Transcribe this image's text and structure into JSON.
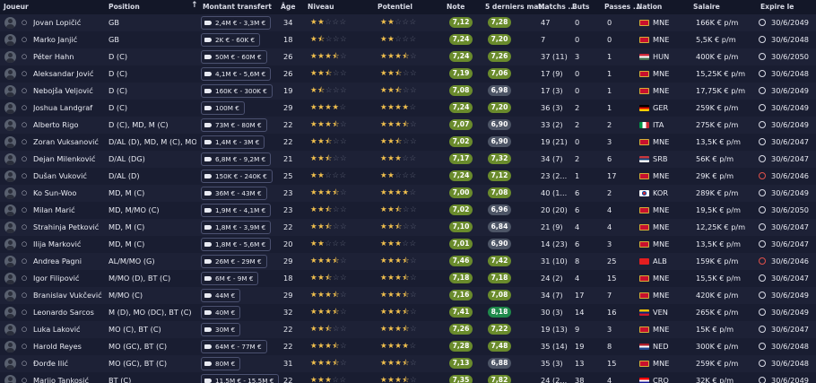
{
  "headers": {
    "player": "Joueur",
    "position": "Position",
    "transfer": "Montant transfert",
    "age": "Âge",
    "level": "Niveau",
    "potential": "Potentiel",
    "rating": "Note",
    "last5": "5 derniers mat...",
    "matches": "Matchs ...",
    "goals": "Buts",
    "assists": "Passes ...",
    "nation": "Nation",
    "salary": "Salaire",
    "expires": "Expire le",
    "sort_arrow": "↑"
  },
  "colors": {
    "background": "#161a2c",
    "note_green": "#6a8b2c",
    "star": "#f2c14e",
    "green_dark": "#1f8a4b",
    "grey_badge": "#4d5566",
    "expired_red": "#e0504a"
  },
  "players": [
    {
      "name": "Jovan Lopičić",
      "position": "GB",
      "transfer": "2,4M € - 3,3M €",
      "age": "34",
      "level": 2,
      "potential": 2,
      "note": "7,12",
      "last5": "7,28",
      "last5_style": "g1",
      "matches": "47",
      "goals": "0",
      "assists": "0",
      "flag": "mne",
      "nation": "MNE",
      "salary": "166K € p/m",
      "clock": "normal",
      "expires": "30/6/2049"
    },
    {
      "name": "Marko Janjić",
      "position": "GB",
      "transfer": "2K € - 60K €",
      "age": "18",
      "level": 1.5,
      "potential": 2,
      "note": "7,24",
      "last5": "7,20",
      "last5_style": "g1",
      "matches": "7",
      "goals": "0",
      "assists": "0",
      "flag": "mne",
      "nation": "MNE",
      "salary": "5,5K € p/m",
      "clock": "normal",
      "expires": "30/6/2048"
    },
    {
      "name": "Péter Hahn",
      "position": "D (C)",
      "transfer": "50M € - 60M €",
      "age": "26",
      "level": 3.5,
      "potential": 3.5,
      "note": "7,24",
      "last5": "7,26",
      "last5_style": "g1",
      "matches": "37 (11)",
      "goals": "3",
      "assists": "1",
      "flag": "hun",
      "nation": "HUN",
      "salary": "400K € p/m",
      "clock": "normal",
      "expires": "30/6/2050"
    },
    {
      "name": "Aleksandar Jović",
      "position": "D (C)",
      "transfer": "4,1M € - 5,6M €",
      "age": "26",
      "level": 2.5,
      "potential": 2.5,
      "note": "7,19",
      "last5": "7,06",
      "last5_style": "g1",
      "matches": "17 (9)",
      "goals": "0",
      "assists": "1",
      "flag": "mne",
      "nation": "MNE",
      "salary": "15,25K € p/m",
      "clock": "normal",
      "expires": "30/6/2048"
    },
    {
      "name": "Nebojša Veljović",
      "position": "D (C)",
      "transfer": "160K € - 300K €",
      "age": "19",
      "level": 1.5,
      "potential": 2.5,
      "note": "7,08",
      "last5": "6,98",
      "last5_style": "g2",
      "matches": "17 (3)",
      "goals": "0",
      "assists": "1",
      "flag": "mne",
      "nation": "MNE",
      "salary": "17,75K € p/m",
      "clock": "normal",
      "expires": "30/6/2049"
    },
    {
      "name": "Joshua Landgraf",
      "position": "D (C)",
      "transfer": "100M €",
      "age": "29",
      "level": 4,
      "potential": 4,
      "note": "7,24",
      "last5": "7,20",
      "last5_style": "g1",
      "matches": "36 (3)",
      "goals": "2",
      "assists": "1",
      "flag": "ger",
      "nation": "GER",
      "salary": "259K € p/m",
      "clock": "normal",
      "expires": "30/6/2049"
    },
    {
      "name": "Alberto Rigo",
      "position": "D (C), MD, M (C)",
      "transfer": "73M € - 80M €",
      "age": "22",
      "level": 3.5,
      "potential": 3.5,
      "note": "7,07",
      "last5": "6,90",
      "last5_style": "g2",
      "matches": "33 (2)",
      "goals": "2",
      "assists": "2",
      "flag": "ita",
      "nation": "ITA",
      "salary": "275K € p/m",
      "clock": "normal",
      "expires": "30/6/2049"
    },
    {
      "name": "Zoran Vuksanović",
      "position": "D/AL (D), MD, M (C), MO...",
      "transfer": "1,4M € - 3M €",
      "age": "22",
      "level": 2.5,
      "potential": 2.5,
      "note": "7,02",
      "last5": "6,90",
      "last5_style": "g2",
      "matches": "19 (21)",
      "goals": "0",
      "assists": "3",
      "flag": "mne",
      "nation": "MNE",
      "salary": "13,5K € p/m",
      "clock": "normal",
      "expires": "30/6/2047"
    },
    {
      "name": "Dejan Milenković",
      "position": "D/AL (DG)",
      "transfer": "6,8M € - 9,2M €",
      "age": "21",
      "level": 2.5,
      "potential": 3,
      "note": "7,17",
      "last5": "7,32",
      "last5_style": "g1",
      "matches": "34 (7)",
      "goals": "2",
      "assists": "6",
      "flag": "srb",
      "nation": "SRB",
      "salary": "56K € p/m",
      "clock": "normal",
      "expires": "30/6/2047"
    },
    {
      "name": "Dušan Vuković",
      "position": "D/AL (D)",
      "transfer": "150K € - 240K €",
      "age": "25",
      "level": 2,
      "potential": 2,
      "note": "7,24",
      "last5": "7,12",
      "last5_style": "g1",
      "matches": "23 (2...",
      "goals": "1",
      "assists": "17",
      "flag": "mne",
      "nation": "MNE",
      "salary": "29K € p/m",
      "clock": "red",
      "expires": "30/6/2046"
    },
    {
      "name": "Ko Sun-Woo",
      "position": "MD, M (C)",
      "transfer": "36M € - 43M €",
      "age": "23",
      "level": 3.5,
      "potential": 4,
      "note": "7,00",
      "last5": "7,08",
      "last5_style": "g1",
      "matches": "40 (1...",
      "goals": "6",
      "assists": "2",
      "flag": "kor",
      "nation": "KOR",
      "salary": "289K € p/m",
      "clock": "normal",
      "expires": "30/6/2049"
    },
    {
      "name": "Milan Marić",
      "position": "MD, M/MO (C)",
      "transfer": "1,9M € - 4,1M €",
      "age": "23",
      "level": 2.5,
      "potential": 2.5,
      "note": "7,02",
      "last5": "6,96",
      "last5_style": "g2",
      "matches": "20 (20)",
      "goals": "6",
      "assists": "4",
      "flag": "mne",
      "nation": "MNE",
      "salary": "19,5K € p/m",
      "clock": "normal",
      "expires": "30/6/2050"
    },
    {
      "name": "Strahinja Petković",
      "position": "MD, M (C)",
      "transfer": "1,8M € - 3,9M €",
      "age": "22",
      "level": 2.5,
      "potential": 2.5,
      "note": "7,10",
      "last5": "6,84",
      "last5_style": "g2",
      "matches": "21 (9)",
      "goals": "4",
      "assists": "4",
      "flag": "mne",
      "nation": "MNE",
      "salary": "12,25K € p/m",
      "clock": "normal",
      "expires": "30/6/2047"
    },
    {
      "name": "Ilija Marković",
      "position": "MD, M (C)",
      "transfer": "1,8M € - 5,6M €",
      "age": "20",
      "level": 2,
      "potential": 3,
      "note": "7,01",
      "last5": "6,90",
      "last5_style": "g2",
      "matches": "14 (23)",
      "goals": "6",
      "assists": "3",
      "flag": "mne",
      "nation": "MNE",
      "salary": "13,5K € p/m",
      "clock": "normal",
      "expires": "30/6/2047"
    },
    {
      "name": "Andrea Pagni",
      "position": "AL/M/MO (G)",
      "transfer": "26M € - 29M €",
      "age": "29",
      "level": 3.5,
      "potential": 3.5,
      "note": "7,46",
      "last5": "7,42",
      "last5_style": "g1",
      "matches": "31 (10)",
      "goals": "8",
      "assists": "25",
      "flag": "alb",
      "nation": "ALB",
      "salary": "159K € p/m",
      "clock": "red",
      "expires": "30/6/2046"
    },
    {
      "name": "Igor Filipović",
      "position": "M/MO (D), BT (C)",
      "transfer": "6M € - 9M €",
      "age": "18",
      "level": 2.5,
      "potential": 3.5,
      "note": "7,18",
      "last5": "7,18",
      "last5_style": "g1",
      "matches": "24 (2)",
      "goals": "4",
      "assists": "15",
      "flag": "mne",
      "nation": "MNE",
      "salary": "15,5K € p/m",
      "clock": "normal",
      "expires": "30/6/2047"
    },
    {
      "name": "Branislav Vukčević",
      "position": "M/MO (C)",
      "transfer": "44M €",
      "age": "29",
      "level": 3.5,
      "potential": 3.5,
      "note": "7,16",
      "last5": "7,08",
      "last5_style": "g1",
      "matches": "34 (7)",
      "goals": "17",
      "assists": "7",
      "flag": "mne",
      "nation": "MNE",
      "salary": "420K € p/m",
      "clock": "normal",
      "expires": "30/6/2049"
    },
    {
      "name": "Leonardo Sarcos",
      "position": "M (D), MO (DC), BT (C)",
      "transfer": "40M €",
      "age": "32",
      "level": 3.5,
      "potential": 3.5,
      "note": "7,41",
      "last5": "8,18",
      "last5_style": "g3",
      "matches": "30 (3)",
      "goals": "14",
      "assists": "16",
      "flag": "ven",
      "nation": "VEN",
      "salary": "265K € p/m",
      "clock": "normal",
      "expires": "30/6/2049"
    },
    {
      "name": "Luka Laković",
      "position": "MO (C), BT (C)",
      "transfer": "30M €",
      "age": "22",
      "level": 2.5,
      "potential": 3.5,
      "note": "7,26",
      "last5": "7,22",
      "last5_style": "g1",
      "matches": "19 (13)",
      "goals": "9",
      "assists": "3",
      "flag": "mne",
      "nation": "MNE",
      "salary": "15K € p/m",
      "clock": "normal",
      "expires": "30/6/2047"
    },
    {
      "name": "Harold Reyes",
      "position": "MO (GC), BT (C)",
      "transfer": "64M € - 77M €",
      "age": "22",
      "level": 3.5,
      "potential": 4,
      "note": "7,28",
      "last5": "7,48",
      "last5_style": "g1",
      "matches": "35 (14)",
      "goals": "19",
      "assists": "8",
      "flag": "ned",
      "nation": "NED",
      "salary": "300K € p/m",
      "clock": "normal",
      "expires": "30/6/2048"
    },
    {
      "name": "Đorđe Ilić",
      "position": "MO (GC), BT (C)",
      "transfer": "80M €",
      "age": "31",
      "level": 3.5,
      "potential": 3.5,
      "note": "7,13",
      "last5": "6,88",
      "last5_style": "g2",
      "matches": "35 (3)",
      "goals": "13",
      "assists": "15",
      "flag": "mne",
      "nation": "MNE",
      "salary": "259K € p/m",
      "clock": "normal",
      "expires": "30/6/2048"
    },
    {
      "name": "Marijo Tankosić",
      "position": "BT (C)",
      "transfer": "11,5M € - 15,5M €",
      "age": "22",
      "level": 3,
      "potential": 3.5,
      "note": "7,35",
      "last5": "7,82",
      "last5_style": "g1",
      "matches": "24 (2...",
      "goals": "38",
      "assists": "4",
      "flag": "cro",
      "nation": "CRO",
      "salary": "32K € p/m",
      "clock": "normal",
      "expires": "30/6/2049"
    }
  ]
}
